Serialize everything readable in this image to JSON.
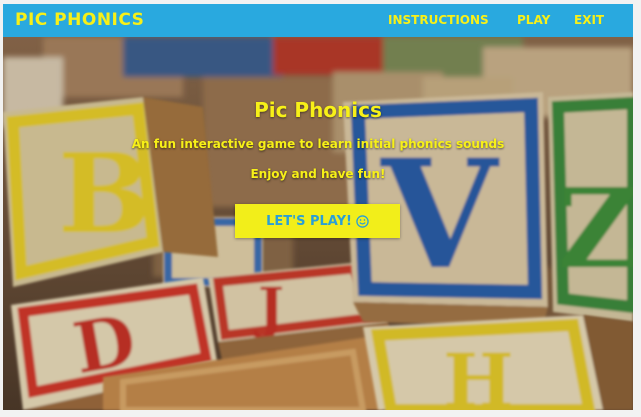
{
  "navbar": {
    "brand": "PIC PHONICS",
    "links": [
      {
        "label": "INSTRUCTIONS"
      },
      {
        "label": "PLAY"
      },
      {
        "label": "EXIT"
      }
    ]
  },
  "hero": {
    "title": "Pic Phonics",
    "subtitle": "An fun interactive game to learn initial phonics sounds",
    "tagline": "Enjoy and have fun!",
    "button_label": "LET'S PLAY!",
    "button_icon": "smiley-icon",
    "background": "photo of wooden alphabet blocks"
  },
  "colors": {
    "navbar": "#29a9df",
    "accent_yellow": "#f7f018",
    "button_bg": "#f2ee1a",
    "button_text": "#2a9fd6"
  }
}
